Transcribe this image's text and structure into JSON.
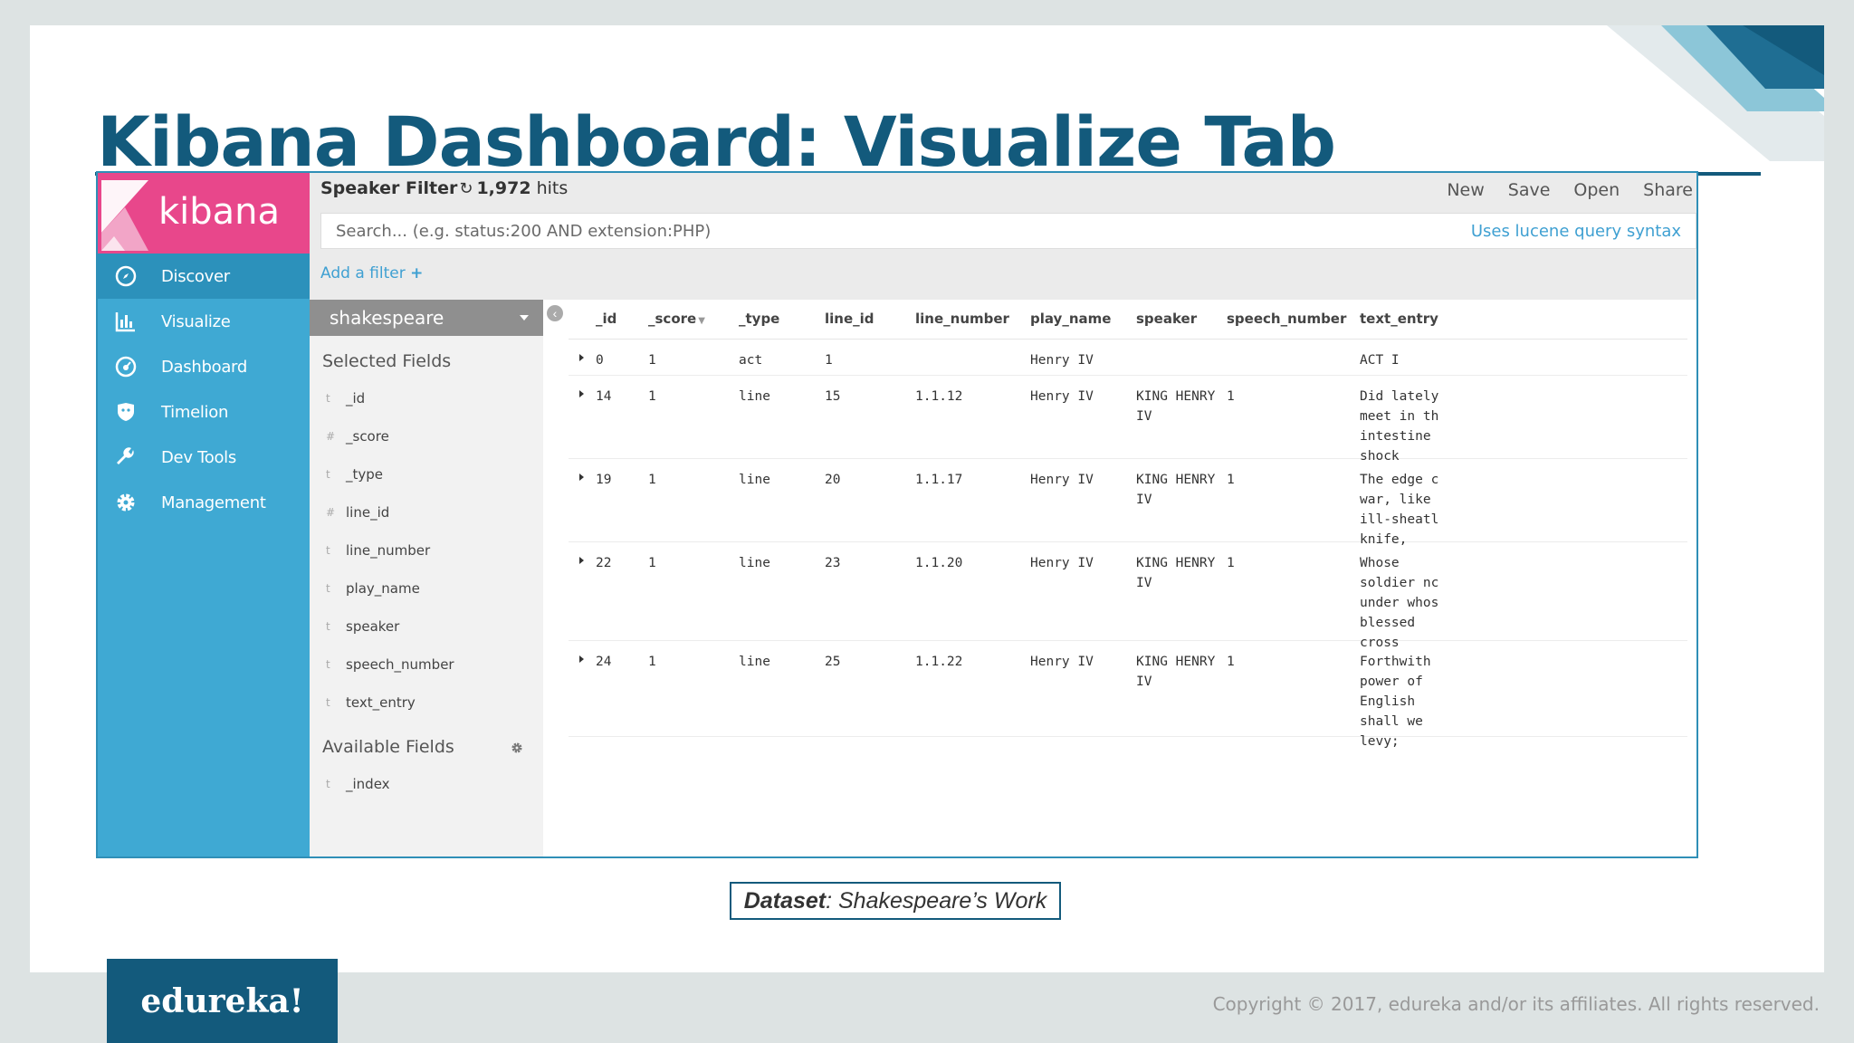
{
  "slide": {
    "title": "Kibana Dashboard: Visualize Tab",
    "caption_bold": "Dataset",
    "caption_rest": ": Shakespeare’s Work",
    "brand": "edureka!",
    "copyright": "Copyright © 2017, edureka and/or its affiliates. All rights reserved."
  },
  "colors": {
    "title": "#135a7c",
    "sidebar": "#3fa9d3",
    "sidebar_active": "#2c91bb",
    "logo_bg": "#e8478b",
    "link": "#3fa0d2"
  },
  "sidebar": {
    "logo_text": "kibana",
    "items": [
      {
        "label": "Discover",
        "icon": "compass-icon",
        "active": true
      },
      {
        "label": "Visualize",
        "icon": "bar-chart-icon",
        "active": false
      },
      {
        "label": "Dashboard",
        "icon": "dashboard-gauge-icon",
        "active": false
      },
      {
        "label": "Timelion",
        "icon": "timelion-shield-icon",
        "active": false
      },
      {
        "label": "Dev Tools",
        "icon": "wrench-icon",
        "active": false
      },
      {
        "label": "Management",
        "icon": "gear-icon",
        "active": false
      }
    ]
  },
  "topbar": {
    "search_name": "Speaker Filter",
    "hits_count": "1,972",
    "hits_label": "hits",
    "actions": [
      "New",
      "Save",
      "Open",
      "Share"
    ],
    "search_placeholder": "Search... (e.g. status:200 AND extension:PHP)",
    "lucene_hint": "Uses lucene query syntax",
    "add_filter": "Add a filter",
    "add_filter_plus": "+"
  },
  "fields_panel": {
    "index": "shakespeare",
    "selected_label": "Selected Fields",
    "selected": [
      {
        "type": "t",
        "name": "_id"
      },
      {
        "type": "#",
        "name": "_score"
      },
      {
        "type": "t",
        "name": "_type"
      },
      {
        "type": "#",
        "name": "line_id"
      },
      {
        "type": "t",
        "name": "line_number"
      },
      {
        "type": "t",
        "name": "play_name"
      },
      {
        "type": "t",
        "name": "speaker"
      },
      {
        "type": "t",
        "name": "speech_number"
      },
      {
        "type": "t",
        "name": "text_entry"
      }
    ],
    "available_label": "Available Fields",
    "available": [
      {
        "type": "t",
        "name": "_index"
      }
    ]
  },
  "table": {
    "columns": [
      "_id",
      "_score",
      "_type",
      "line_id",
      "line_number",
      "play_name",
      "speaker",
      "speech_number",
      "text_entry"
    ],
    "rows": [
      {
        "_id": "0",
        "_score": "1",
        "_type": "act",
        "line_id": "1",
        "line_number": "",
        "play_name": "Henry IV",
        "speaker": "",
        "speech_number": "",
        "text_entry": "ACT I"
      },
      {
        "_id": "14",
        "_score": "1",
        "_type": "line",
        "line_id": "15",
        "line_number": "1.1.12",
        "play_name": "Henry IV",
        "speaker": "KING HENRY\nIV",
        "speech_number": "1",
        "text_entry": "Did lately\nmeet in th\nintestine\nshock"
      },
      {
        "_id": "19",
        "_score": "1",
        "_type": "line",
        "line_id": "20",
        "line_number": "1.1.17",
        "play_name": "Henry IV",
        "speaker": "KING HENRY\nIV",
        "speech_number": "1",
        "text_entry": "The edge c\nwar, like\nill-sheatl\nknife,"
      },
      {
        "_id": "22",
        "_score": "1",
        "_type": "line",
        "line_id": "23",
        "line_number": "1.1.20",
        "play_name": "Henry IV",
        "speaker": "KING HENRY\nIV",
        "speech_number": "1",
        "text_entry": "Whose\nsoldier nc\nunder whos\nblessed\ncross"
      },
      {
        "_id": "24",
        "_score": "1",
        "_type": "line",
        "line_id": "25",
        "line_number": "1.1.22",
        "play_name": "Henry IV",
        "speaker": "KING HENRY\nIV",
        "speech_number": "1",
        "text_entry": "Forthwith\npower of\nEnglish\nshall we\nlevy;"
      }
    ]
  }
}
